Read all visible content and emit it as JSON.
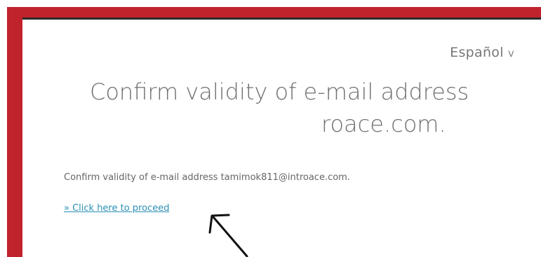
{
  "page": {
    "language_selector": {
      "label": "Español",
      "chevron": "v",
      "icon": "chevron-down-icon"
    },
    "heading": {
      "line1": "Confirm validity of e-mail address",
      "line2": "roace.com."
    },
    "message": "Confirm validity of e-mail address tamimok811@introace.com.",
    "proceed_link": "» Click here to proceed",
    "annotation": {
      "icon": "hand-drawn-arrow-icon"
    },
    "colors": {
      "frame": "#c0232b",
      "link": "#2a8fb6",
      "text": "#666666"
    }
  }
}
